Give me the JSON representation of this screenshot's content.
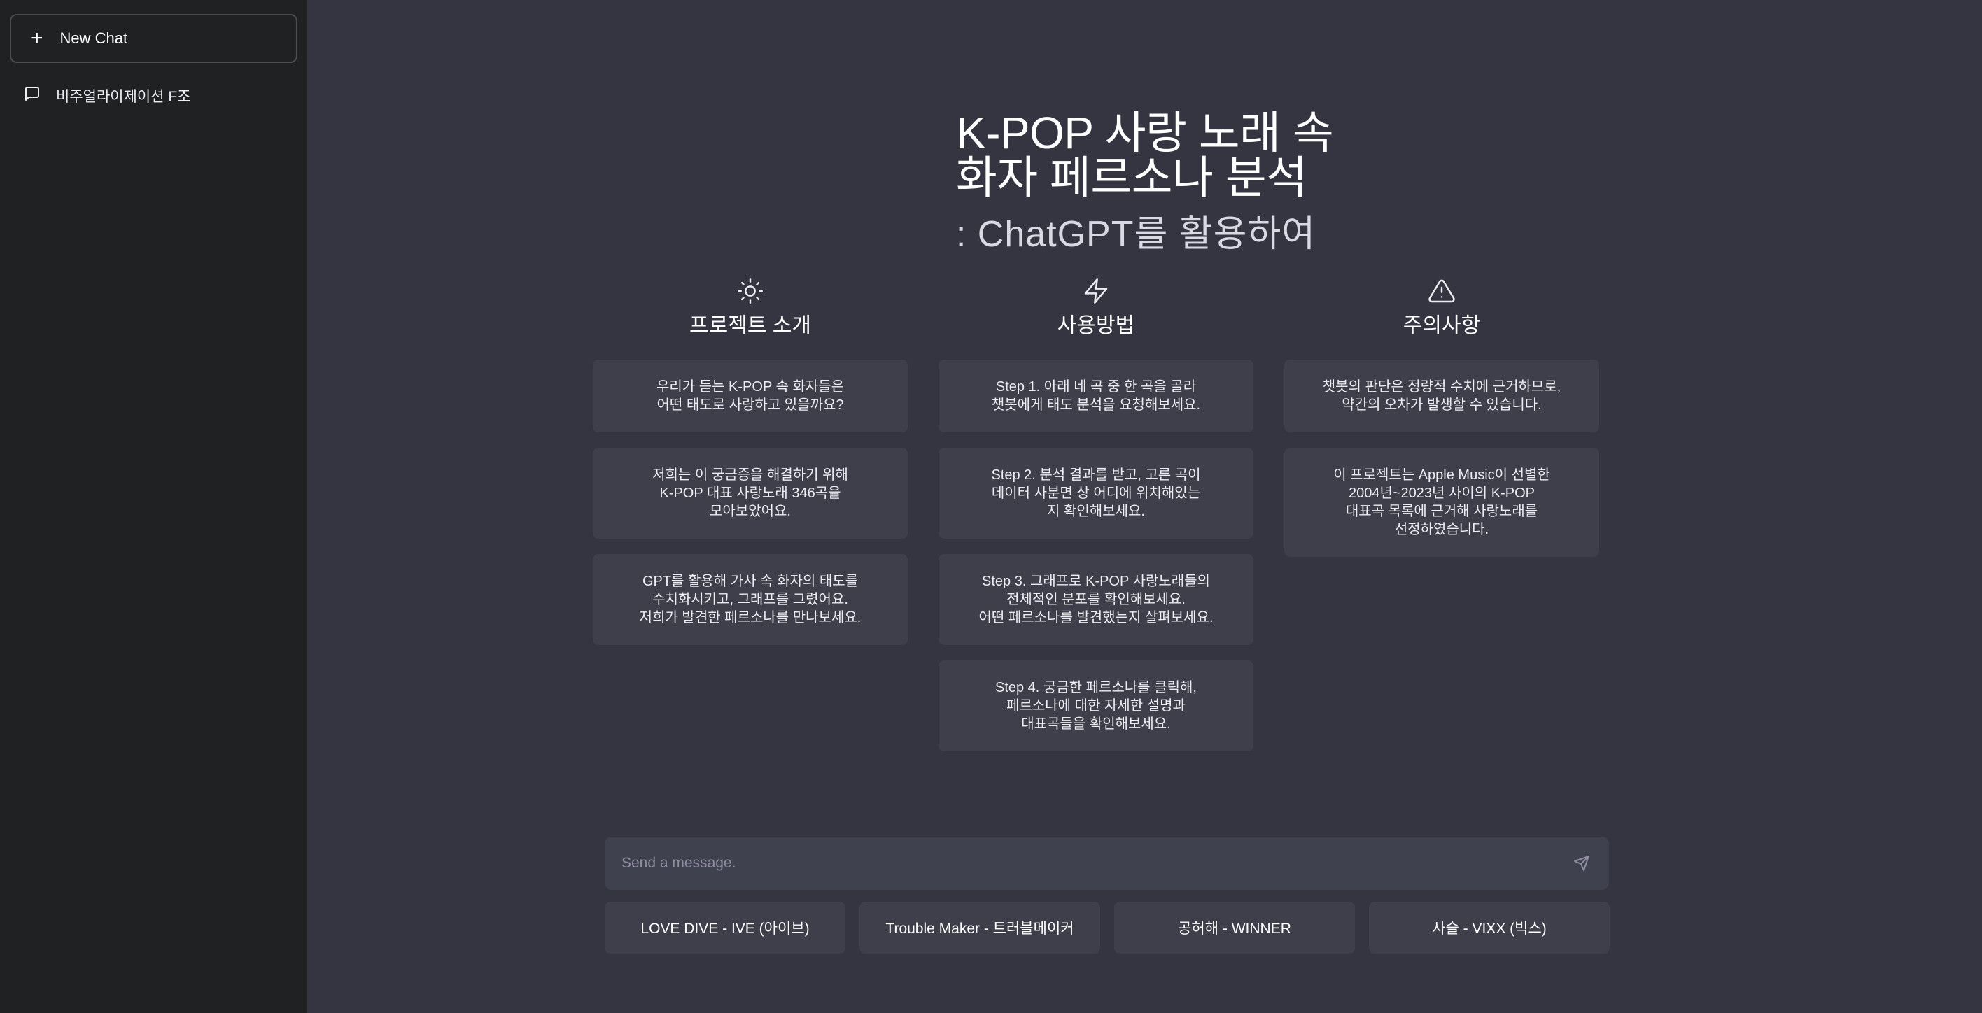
{
  "sidebar": {
    "new_chat_label": "New Chat",
    "chats": [
      {
        "label": "비주얼라이제이션 F조"
      }
    ]
  },
  "header": {
    "title": "K-POP 사랑 노래 속\n화자 페르소나 분석",
    "subtitle": ": ChatGPT를 활용하여"
  },
  "columns": [
    {
      "icon": "sun-icon",
      "title": "프로젝트 소개",
      "cards": [
        "우리가 듣는 K-POP 속 화자들은\n어떤 태도로 사랑하고 있을까요?",
        "저희는 이 궁금증을 해결하기 위해\nK-POP 대표 사랑노래 346곡을\n모아보았어요.",
        "GPT를 활용해 가사 속 화자의 태도를\n수치화시키고, 그래프를 그렸어요.\n저희가 발견한 페르소나를 만나보세요."
      ]
    },
    {
      "icon": "lightning-icon",
      "title": "사용방법",
      "cards": [
        "Step 1. 아래 네 곡 중 한 곡을 골라\n챗봇에게 태도 분석을 요청해보세요.",
        "Step 2. 분석 결과를 받고, 고른 곡이\n데이터 사분면 상 어디에 위치해있는\n지 확인해보세요.",
        "Step 3. 그래프로 K-POP 사랑노래들의\n전체적인 분포를 확인해보세요.\n어떤 페르소나를 발견했는지 살펴보세요.",
        "Step 4. 궁금한 페르소나를 클릭해,\n페르소나에 대한 자세한 설명과\n대표곡들을 확인해보세요."
      ]
    },
    {
      "icon": "warning-icon",
      "title": "주의사항",
      "cards": [
        "챗봇의 판단은 정량적 수치에 근거하므로,\n약간의 오차가 발생할 수 있습니다.",
        "이 프로젝트는 Apple Music이 선별한\n2004년~2023년 사이의 K-POP\n대표곡 목록에 근거해 사랑노래를\n선정하였습니다."
      ]
    }
  ],
  "input": {
    "placeholder": "Send a message."
  },
  "suggestions": [
    "LOVE DIVE - IVE (아이브)",
    "Trouble Maker - 트러블메이커",
    "공허해 - WINNER",
    "사슬 - VIXX (빅스)"
  ]
}
